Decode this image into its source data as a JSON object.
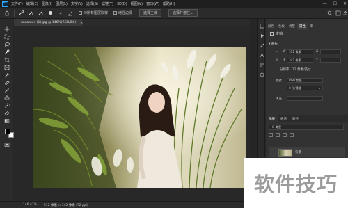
{
  "menubar": {
    "logo": "Ps",
    "items": [
      "文件(F)",
      "编辑(E)",
      "图像(I)",
      "图层(L)",
      "文字(Y)",
      "选择(S)",
      "滤镜(T)",
      "3D(D)",
      "视图(V)",
      "窗口(W)",
      "帮助(H)"
    ],
    "window_controls": [
      "—",
      "☐",
      "✕"
    ]
  },
  "options_bar": {
    "check1_label": "对所有图层取样",
    "check2_label": "增强边缘",
    "select_subject": "选择主体",
    "select_and_mask": "选择并遮住..."
  },
  "document": {
    "tab_title": "unnamed (1).jpg @ 146%(RGB/8#)",
    "tab_close": "×"
  },
  "statusbar": {
    "zoom": "146.41%",
    "info": "512 像素 × 342 像素 (72 ppi)"
  },
  "properties": {
    "tabs": [
      "颜色",
      "色板",
      "调整",
      "属性",
      "库"
    ],
    "active_tab": "属性",
    "title": "文档",
    "section": "画布",
    "w_label": "W",
    "w_value": "512 像素",
    "h_label": "H",
    "h_value": "342 像素",
    "x_label": "X",
    "y_label": "Y",
    "resolution": "分辨率：72 像素/英寸",
    "mode_label": "模式",
    "mode_value": "RGB 颜色",
    "bitdepth_value": "8 位/通道",
    "fill_label": "填充"
  },
  "layers": {
    "tabs": [
      "图层",
      "通道",
      "路径"
    ],
    "active_tab": "图层",
    "filter_placeholder": "Q 类型",
    "layer_name": "背景"
  },
  "watermark": "软件技巧",
  "colors": {
    "foreground": "#000000",
    "background": "#ffffff",
    "accent": "#31a8ff"
  }
}
